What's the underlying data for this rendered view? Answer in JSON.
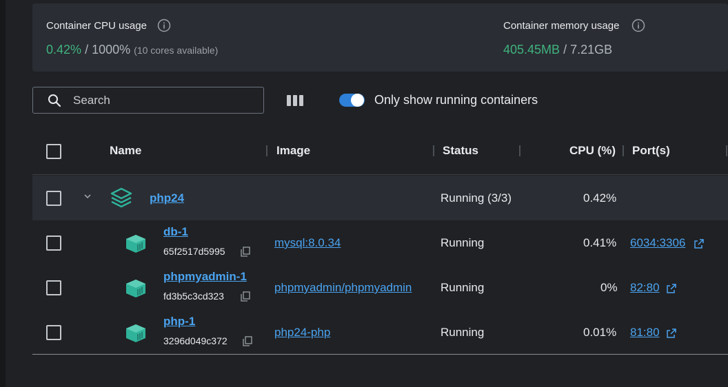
{
  "stats": {
    "cpu": {
      "title": "Container CPU usage",
      "used": "0.42%",
      "separator": "/",
      "total": "1000%",
      "note": "(10 cores available)"
    },
    "memory": {
      "title": "Container memory usage",
      "used": "405.45MB",
      "separator": "/",
      "total": "7.21GB"
    }
  },
  "toolbar": {
    "search_placeholder": "Search",
    "toggle_label": "Only show running containers",
    "toggle_on": true
  },
  "table": {
    "headers": {
      "name": "Name",
      "image": "Image",
      "status": "Status",
      "cpu": "CPU (%)",
      "ports": "Port(s)"
    },
    "group": {
      "name": "php24",
      "status": "Running (3/3)",
      "cpu": "0.42%"
    },
    "rows": [
      {
        "name": "db-1",
        "id": "65f2517d5995",
        "image": "mysql:8.0.34",
        "status": "Running",
        "cpu": "0.41%",
        "port": "6034:3306"
      },
      {
        "name": "phpmyadmin-1",
        "id": "fd3b5c3cd323",
        "image": "phpmyadmin/phpmyadmin",
        "status": "Running",
        "cpu": "0%",
        "port": "82:80"
      },
      {
        "name": "php-1",
        "id": "3296d049c372",
        "image": "php24-php",
        "status": "Running",
        "cpu": "0.01%",
        "port": "81:80"
      }
    ]
  },
  "colors": {
    "accent_green": "#3fb37f",
    "link_blue": "#4aa3f0",
    "toggle_blue": "#2e80d9",
    "container_teal": "#2fb39a"
  },
  "icons": {
    "info": "info-icon",
    "search": "search-icon",
    "columns": "columns-icon",
    "stack": "stack-icon",
    "container": "container-icon",
    "copy": "copy-icon",
    "external_link": "external-link-icon",
    "chevron": "chevron-down-icon"
  }
}
